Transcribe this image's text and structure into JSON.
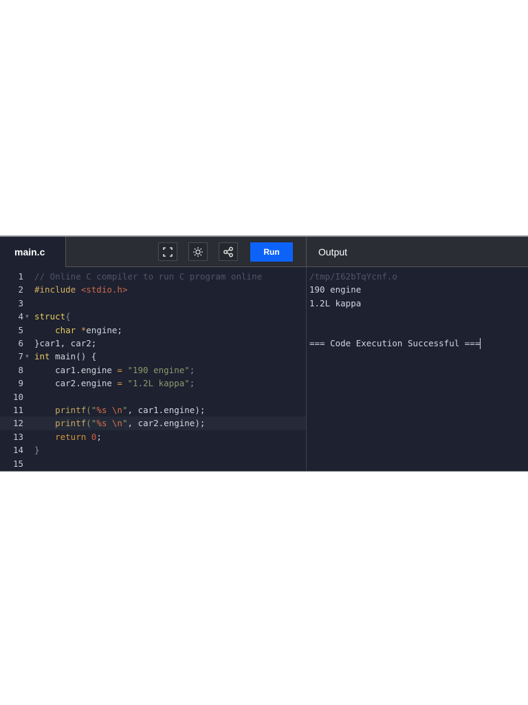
{
  "tab": {
    "label": "main.c"
  },
  "toolbar": {
    "fullscreen_icon": "fullscreen-icon",
    "theme_icon": "sun-icon",
    "share_icon": "share-icon",
    "run_label": "Run",
    "run_color": "#0d63f8"
  },
  "output": {
    "title": "Output",
    "lines": [
      "/tmp/I62bTqYcnf.o",
      "190 engine",
      "1.2L kappa",
      "",
      "=== Code Execution Successful ==="
    ]
  },
  "editor": {
    "active_line": 12,
    "lines": [
      {
        "n": "1",
        "tokens": [
          [
            "// Online C compiler to run C program online",
            "comment"
          ]
        ]
      },
      {
        "n": "2",
        "tokens": [
          [
            "#include ",
            "pre"
          ],
          [
            "<stdio.h>",
            "inc"
          ]
        ]
      },
      {
        "n": "3",
        "tokens": []
      },
      {
        "n": "4",
        "fold": true,
        "tokens": [
          [
            "struct",
            "kw"
          ],
          [
            "{",
            "dim"
          ]
        ]
      },
      {
        "n": "5",
        "tokens": [
          [
            "    ",
            ""
          ],
          [
            "char",
            "kw"
          ],
          [
            " ",
            ""
          ],
          [
            "*",
            "op"
          ],
          [
            "engine;",
            ""
          ]
        ]
      },
      {
        "n": "6",
        "tokens": [
          [
            "}car1, car2;",
            ""
          ]
        ]
      },
      {
        "n": "7",
        "fold": true,
        "tokens": [
          [
            "int",
            "kw"
          ],
          [
            " main() {",
            ""
          ]
        ]
      },
      {
        "n": "8",
        "tokens": [
          [
            "    car1.engine ",
            ""
          ],
          [
            "=",
            "op"
          ],
          [
            " \"190 engine\"",
            "str"
          ],
          [
            ";",
            "dim"
          ]
        ]
      },
      {
        "n": "9",
        "tokens": [
          [
            "    car2.engine ",
            ""
          ],
          [
            "=",
            "op"
          ],
          [
            " \"1.2L kappa\"",
            "str"
          ],
          [
            ";",
            "dim"
          ]
        ]
      },
      {
        "n": "10",
        "tokens": []
      },
      {
        "n": "11",
        "tokens": [
          [
            "    ",
            ""
          ],
          [
            "printf",
            "fn"
          ],
          [
            "(\"",
            "str"
          ],
          [
            "%s \\n",
            "esc"
          ],
          [
            "\"",
            "str"
          ],
          [
            ", car1.engine);",
            ""
          ]
        ]
      },
      {
        "n": "12",
        "tokens": [
          [
            "    ",
            ""
          ],
          [
            "printf",
            "fn"
          ],
          [
            "(\"",
            "str"
          ],
          [
            "%s \\n",
            "esc"
          ],
          [
            "\"",
            "str"
          ],
          [
            ", car2.engine);",
            ""
          ]
        ]
      },
      {
        "n": "13",
        "tokens": [
          [
            "    ",
            ""
          ],
          [
            "return",
            "ret"
          ],
          [
            " ",
            ""
          ],
          [
            "0",
            "num"
          ],
          [
            ";",
            ""
          ]
        ]
      },
      {
        "n": "14",
        "tokens": [
          [
            "}",
            "dim"
          ]
        ]
      },
      {
        "n": "15",
        "tokens": []
      }
    ]
  }
}
